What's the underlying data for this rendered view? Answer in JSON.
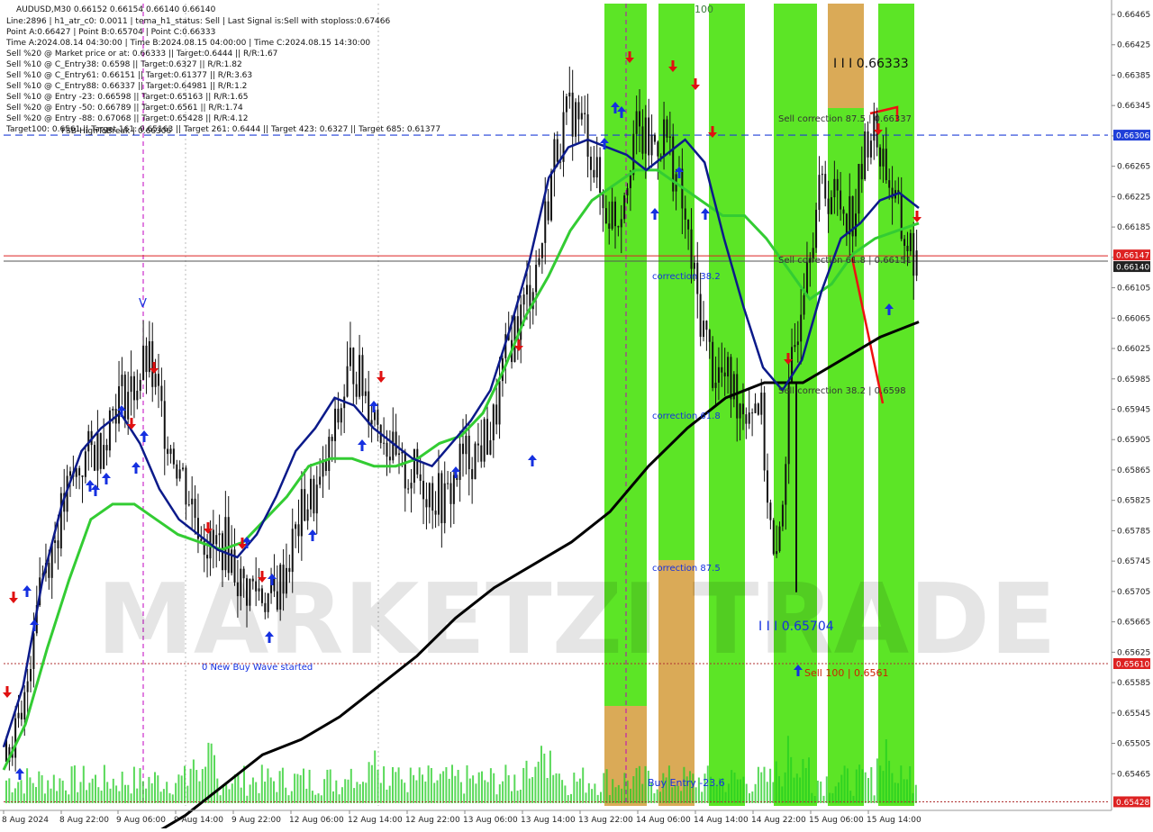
{
  "chart_data": {
    "type": "candlestick",
    "symbol": "AUDUSD,M30",
    "ohlc_header": "AUDUSD,M30   0.66152 0.66154 0.66140 0.66140",
    "info_lines": [
      "Line:2896 | h1_atr_c0: 0.0011 | tema_h1_status: Sell | Last Signal is:Sell with stoploss:0.67466",
      "Point A:0.66427 | Point B:0.65704 | Point C:0.66333",
      "Time A:2024.08.14 04:30:00 | Time B:2024.08.15 04:00:00 | Time C:2024.08.15 14:30:00",
      "Sell %20 @ Market price or at: 0.66333 || Target:0.6444 || R/R:1.67",
      "Sell %10 @ C_Entry38: 0.6598 || Target:0.6327 || R/R:1.82",
      "Sell %10 @ C_Entry61: 0.66151 || Target:0.61377 || R/R:3.63",
      "Sell %10 @ C_Entry88: 0.66337 || Target:0.64981 || R/R:1.2",
      "Sell %10 @ Entry -23: 0.66598 || Target:0.65163 || R/R:1.65",
      "Sell %20 @ Entry -50: 0.66789 || Target:0.6561 || R/R:1.74",
      "Sell %20 @ Entry -88: 0.67068 || Target:0.65428 || R/R:4.12",
      "Target100: 0.6561 || Target 161: 0.65163 || Target 261: 0.6444 || Target 423: 0.6327 || Target 685: 0.61377"
    ],
    "y_ticks": [
      "0.66465",
      "0.66425",
      "0.66385",
      "0.66345",
      "0.66305",
      "0.66265",
      "0.66225",
      "0.66185",
      "0.66145",
      "0.66105",
      "0.66065",
      "0.66025",
      "0.65985",
      "0.65945",
      "0.65905",
      "0.65865",
      "0.65825",
      "0.65785",
      "0.65745",
      "0.65705",
      "0.65665",
      "0.65625",
      "0.65585",
      "0.65545",
      "0.65505",
      "0.65465"
    ],
    "x_ticks": [
      "8 Aug 2024",
      "8 Aug 22:00",
      "9 Aug 06:00",
      "9 Aug 14:00",
      "9 Aug 22:00",
      "12 Aug 06:00",
      "12 Aug 14:00",
      "12 Aug 22:00",
      "13 Aug 06:00",
      "13 Aug 14:00",
      "13 Aug 22:00",
      "14 Aug 06:00",
      "14 Aug 14:00",
      "14 Aug 22:00",
      "15 Aug 06:00",
      "15 Aug 14:00"
    ],
    "ylim": [
      0.65415,
      0.66485
    ],
    "price_badges": [
      {
        "label": "0.66306",
        "value": 0.66306,
        "color": "#1f3fd8"
      },
      {
        "label": "0.66147",
        "value": 0.66147,
        "color": "#dd2222"
      },
      {
        "label": "0.66140",
        "value": 0.6614,
        "color": "#222222"
      },
      {
        "label": "0.65610",
        "value": 0.6561,
        "color": "#dd2222"
      },
      {
        "label": "0.65428",
        "value": 0.65428,
        "color": "#dd2222"
      }
    ],
    "annotations": {
      "sell_corr_875": "Sell correction 87.5 | 0.66337",
      "sell_corr_618": "Sell correction 61.8 | 0.66151",
      "sell_corr_382": "Sell correction 38.2 | 0.6598",
      "point_c": "I I I 0.66333",
      "point_b": "I I I 0.65704",
      "sell_100": "Sell 100 | 0.6561",
      "corr_382": "correction 38.2",
      "corr_618": "correction 61.8",
      "corr_875": "correction 87.5",
      "buy_entry": "Buy Entry -23.6",
      "new_buy_wave": "0 New Buy Wave started",
      "top_label": "100",
      "v_label": "V",
      "fse_label": "FSB-HighToBreak | 0.66306"
    },
    "watermark": "MARKETZI TRADE",
    "close_path": [
      0.6551,
      0.6552,
      0.6572,
      0.6577,
      0.6584,
      0.6588,
      0.659,
      0.6596,
      0.6597,
      0.6601,
      0.6593,
      0.6587,
      0.6581,
      0.6576,
      0.6577,
      0.6571,
      0.6571,
      0.6569,
      0.6575,
      0.6582,
      0.6584,
      0.6592,
      0.6601,
      0.6596,
      0.6592,
      0.6586,
      0.6586,
      0.6584,
      0.6582,
      0.6588,
      0.6589,
      0.6592,
      0.6603,
      0.6608,
      0.6615,
      0.6629,
      0.6634,
      0.6631,
      0.6621,
      0.662,
      0.6631,
      0.6629,
      0.6631,
      0.6622,
      0.6609,
      0.66,
      0.6598,
      0.6595,
      0.6596,
      0.6571,
      0.6599,
      0.6616,
      0.6624,
      0.6622,
      0.662,
      0.6632,
      0.6627,
      0.6618,
      0.6614
    ],
    "ma_fast_path": [
      0.655,
      0.6558,
      0.6572,
      0.6582,
      0.6589,
      0.6592,
      0.6594,
      0.659,
      0.6584,
      0.658,
      0.6578,
      0.6576,
      0.6575,
      0.6578,
      0.6583,
      0.6589,
      0.6592,
      0.6596,
      0.6595,
      0.6592,
      0.659,
      0.6588,
      0.6587,
      0.659,
      0.6593,
      0.6597,
      0.6605,
      0.6614,
      0.6625,
      0.6629,
      0.663,
      0.6629,
      0.6628,
      0.6626,
      0.6628,
      0.663,
      0.6627,
      0.6617,
      0.6608,
      0.66,
      0.6597,
      0.6601,
      0.661,
      0.6617,
      0.6619,
      0.6622,
      0.6623,
      0.6621
    ],
    "ma_mid_path": [
      0.6547,
      0.6553,
      0.6563,
      0.6572,
      0.658,
      0.6582,
      0.6582,
      0.658,
      0.6578,
      0.6577,
      0.6576,
      0.6577,
      0.658,
      0.6583,
      0.6587,
      0.6588,
      0.6588,
      0.6587,
      0.6587,
      0.6588,
      0.659,
      0.6591,
      0.6594,
      0.66,
      0.6607,
      0.6612,
      0.6618,
      0.6622,
      0.6624,
      0.6626,
      0.6626,
      0.6624,
      0.6622,
      0.662,
      0.662,
      0.6617,
      0.6613,
      0.6609,
      0.6611,
      0.6615,
      0.6617,
      0.6618,
      0.6619
    ],
    "ma_slow_path": [
      0.6535,
      0.6538,
      0.6541,
      0.6545,
      0.6549,
      0.6551,
      0.6554,
      0.6558,
      0.6562,
      0.6567,
      0.6571,
      0.6574,
      0.6577,
      0.6581,
      0.6587,
      0.6592,
      0.6596,
      0.6598,
      0.6598,
      0.6601,
      0.6604,
      0.6606
    ],
    "colors": {
      "zone_green": "#3fe000",
      "zone_orange": "#f0a060",
      "candle": "#111111",
      "ma_fast": "#0b1a8a",
      "ma_mid": "#33cc33",
      "ma_slow": "#000000",
      "up_arrow": "#1530e0",
      "down_arrow": "#e01010",
      "volume": "#22cc22"
    }
  }
}
